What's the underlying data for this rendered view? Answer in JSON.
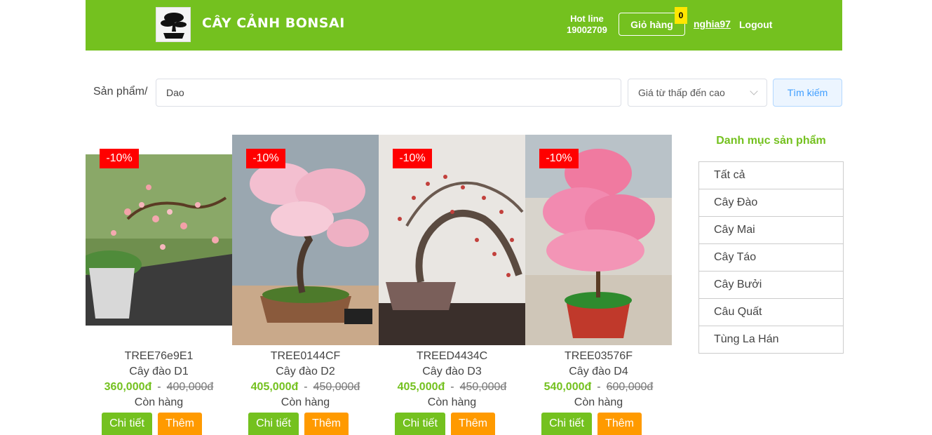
{
  "header": {
    "brand": "CÂY CẢNH BONSAI",
    "hotline_label": "Hot line",
    "hotline_number": "19002709",
    "cart_label": "Giỏ hàng",
    "cart_count": "0",
    "username": "nghia97",
    "logout_label": "Logout",
    "accent_color": "#74c11f"
  },
  "search": {
    "breadcrumb": "Sản phẩm/",
    "query": "Dao",
    "sort_selected": "Giá từ thấp đến cao",
    "button_label": "Tìm kiếm"
  },
  "products": [
    {
      "discount": "-10%",
      "code": "TREE76e9E1",
      "name": "Cây đào D1",
      "price": "360,000đ",
      "dash": "-",
      "old_price": "400,000đ",
      "stock": "Còn hàng",
      "detail_label": "Chi tiết",
      "add_label": "Thêm"
    },
    {
      "discount": "-10%",
      "code": "TREE0144CF",
      "name": "Cây đào D2",
      "price": "405,000đ",
      "dash": "-",
      "old_price": "450,000đ",
      "stock": "Còn hàng",
      "detail_label": "Chi tiết",
      "add_label": "Thêm"
    },
    {
      "discount": "-10%",
      "code": "TREED4434C",
      "name": "Cây đào D3",
      "price": "405,000đ",
      "dash": "-",
      "old_price": "450,000đ",
      "stock": "Còn hàng",
      "detail_label": "Chi tiết",
      "add_label": "Thêm"
    },
    {
      "discount": "-10%",
      "code": "TREE03576F",
      "name": "Cây đào D4",
      "price": "540,000đ",
      "dash": "-",
      "old_price": "600,000đ",
      "stock": "Còn hàng",
      "detail_label": "Chi tiết",
      "add_label": "Thêm"
    }
  ],
  "categories": {
    "title": "Danh mục sản phẩm",
    "items": [
      "Tất cả",
      "Cây Đào",
      "Cây Mai",
      "Cây Táo",
      "Cây Bưởi",
      "Câu Quất",
      "Tùng La Hán"
    ]
  }
}
